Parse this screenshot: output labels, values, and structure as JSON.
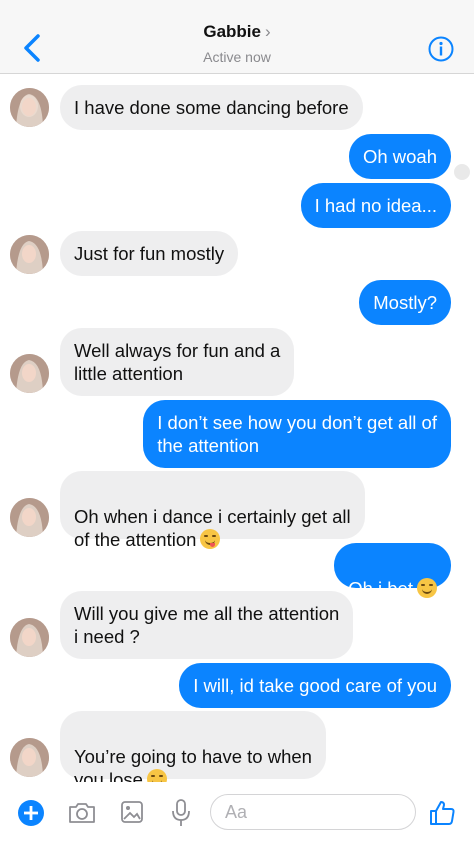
{
  "header": {
    "contact_name": "Gabbie",
    "status": "Active now",
    "back_icon": "chevron-left-icon",
    "info_icon": "info-circle-icon"
  },
  "messages": [
    {
      "side": "in",
      "text": "I have done some dancing before"
    },
    {
      "side": "out",
      "text": "Oh woah"
    },
    {
      "side": "out",
      "text": "I had no idea..."
    },
    {
      "side": "in",
      "text": "Just for fun mostly"
    },
    {
      "side": "out",
      "text": "Mostly?"
    },
    {
      "side": "in",
      "text": "Well always for fun and a\nlittle attention"
    },
    {
      "side": "out",
      "text": "I don’t see how you don’t get all of\nthe attention"
    },
    {
      "side": "in",
      "text": "Oh when i dance i certainly get all\nof the attention",
      "emoji": "face-savoring-food"
    },
    {
      "side": "out",
      "text": "Oh i bet",
      "emoji": "grinning-sweat"
    },
    {
      "side": "in",
      "text": "Will you give me all the attention\ni need ?"
    },
    {
      "side": "out",
      "text": "I will, id take good care of you"
    },
    {
      "side": "in",
      "text": "You’re going to have to when\nyou lose",
      "emoji": "face-savoring-food"
    }
  ],
  "composer": {
    "placeholder": "Aa",
    "icons": [
      "plus-icon",
      "camera-icon",
      "image-icon",
      "microphone-icon",
      "thumbs-up-icon"
    ]
  },
  "colors": {
    "outgoing_bubble": "#0b84ff",
    "incoming_bubble": "#eeeeef",
    "accent": "#0b84ff"
  }
}
